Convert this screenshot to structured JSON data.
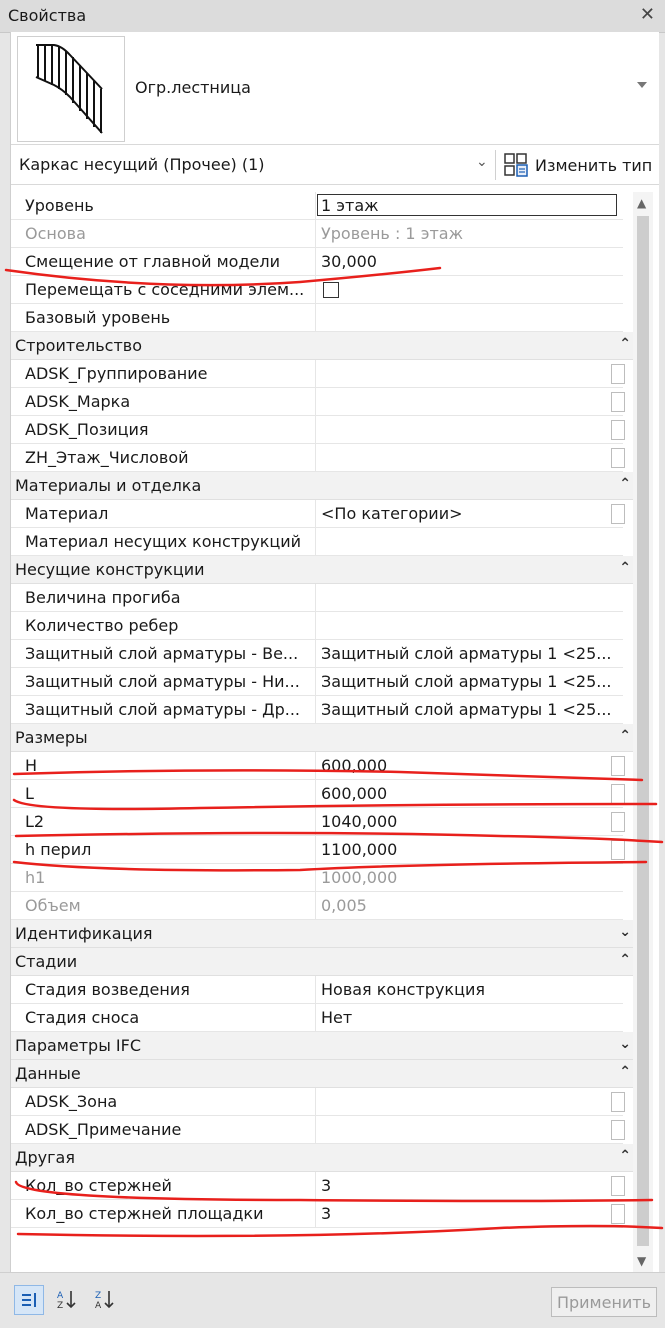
{
  "window": {
    "title": "Свойства"
  },
  "type_selector": {
    "name": "Огр.лестница"
  },
  "filter": {
    "label": "Каркас несущий (Прочее) (1)",
    "edit_type_label": "Изменить тип"
  },
  "rows": [
    {
      "name": "Уровень",
      "value": "1 этаж",
      "style": "boxed"
    },
    {
      "name": "Основа",
      "value": "Уровень : 1 этаж",
      "style": "gray"
    },
    {
      "name": "Смещение от главной модели",
      "value": "30,000"
    },
    {
      "name": "Перемещать с соседними элем...",
      "value": "",
      "style": "checkbox"
    },
    {
      "name": "Базовый уровень",
      "value": ""
    }
  ],
  "groups": [
    {
      "label": "Строительство",
      "state": "expanded",
      "rows": [
        {
          "name": "ADSK_Группирование",
          "value": "",
          "cb": true
        },
        {
          "name": "ADSK_Марка",
          "value": "",
          "cb": true
        },
        {
          "name": "ADSK_Позиция",
          "value": "",
          "cb": true
        },
        {
          "name": "ZH_Этаж_Числовой",
          "value": "",
          "cb": true
        }
      ]
    },
    {
      "label": "Материалы и отделка",
      "state": "expanded",
      "rows": [
        {
          "name": "Материал",
          "value": "<По категории>",
          "cb": true
        },
        {
          "name": "Материал несущих конструкций",
          "value": ""
        }
      ]
    },
    {
      "label": "Несущие конструкции",
      "state": "expanded",
      "rows": [
        {
          "name": "Величина прогиба",
          "value": ""
        },
        {
          "name": "Количество ребер",
          "value": ""
        },
        {
          "name": "Защитный слой арматуры - Ве...",
          "value": "Защитный слой арматуры 1 <25..."
        },
        {
          "name": "Защитный слой арматуры - Ни...",
          "value": "Защитный слой арматуры 1 <25..."
        },
        {
          "name": "Защитный слой арматуры - Др...",
          "value": "Защитный слой арматуры 1 <25..."
        }
      ]
    },
    {
      "label": "Размеры",
      "state": "expanded",
      "rows": [
        {
          "name": "H",
          "value": "600,000",
          "cb": true
        },
        {
          "name": "L",
          "value": "600,000",
          "cb": true
        },
        {
          "name": "L2",
          "value": "1040,000",
          "cb": true
        },
        {
          "name": "h перил",
          "value": "1100,000",
          "cb": true
        },
        {
          "name": "h1",
          "value": "1000,000",
          "style": "gray"
        },
        {
          "name": "Объем",
          "value": "0,005",
          "style": "gray"
        }
      ]
    },
    {
      "label": "Идентификация",
      "state": "collapsed",
      "rows": []
    },
    {
      "label": "Стадии",
      "state": "expanded",
      "rows": [
        {
          "name": "Стадия возведения",
          "value": "Новая конструкция"
        },
        {
          "name": "Стадия сноса",
          "value": "Нет"
        }
      ]
    },
    {
      "label": "Параметры IFC",
      "state": "collapsed",
      "rows": []
    },
    {
      "label": "Данные",
      "state": "expanded",
      "rows": [
        {
          "name": "ADSK_Зона",
          "value": "",
          "cb": true
        },
        {
          "name": "ADSK_Примечание",
          "value": "",
          "cb": true
        }
      ]
    },
    {
      "label": "Другая",
      "state": "expanded",
      "rows": [
        {
          "name": "Кол_во стержней",
          "value": "3",
          "cb": true
        },
        {
          "name": "Кол_во стержней площадки",
          "value": "3",
          "cb": true
        }
      ]
    }
  ],
  "bottom": {
    "apply_label": "Применить"
  },
  "colors": {
    "annotation": "#e8201c",
    "group_bg": "#f2f2f2"
  },
  "icons": {
    "collapse": "collapse-chevron-icon",
    "expand": "expand-chevron-icon"
  }
}
